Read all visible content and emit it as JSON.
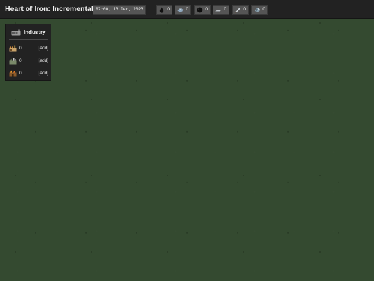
{
  "header": {
    "title": "Heart of Iron: Incremental",
    "datetime": "02:00, 13 Dec, 2023"
  },
  "resources": [
    {
      "name": "oil",
      "icon": "oil-drop-icon",
      "value": "0"
    },
    {
      "name": "aluminium",
      "icon": "aluminium-ore-icon",
      "value": "0"
    },
    {
      "name": "rubber",
      "icon": "rubber-ball-icon",
      "value": "0"
    },
    {
      "name": "tungsten",
      "icon": "tungsten-bar-icon",
      "value": "0"
    },
    {
      "name": "steel",
      "icon": "steel-blade-icon",
      "value": "0"
    },
    {
      "name": "chromium",
      "icon": "chromium-ore-icon",
      "value": "0"
    }
  ],
  "industry": {
    "title": "Industry",
    "icon": "factory-icon",
    "buildings": [
      {
        "icon": "civilian-factory-icon",
        "count": "0",
        "add_label": "[add]"
      },
      {
        "icon": "military-factory-icon",
        "count": "0",
        "add_label": "[add]"
      },
      {
        "icon": "refinery-icon",
        "count": "0",
        "add_label": "[add]"
      }
    ]
  }
}
